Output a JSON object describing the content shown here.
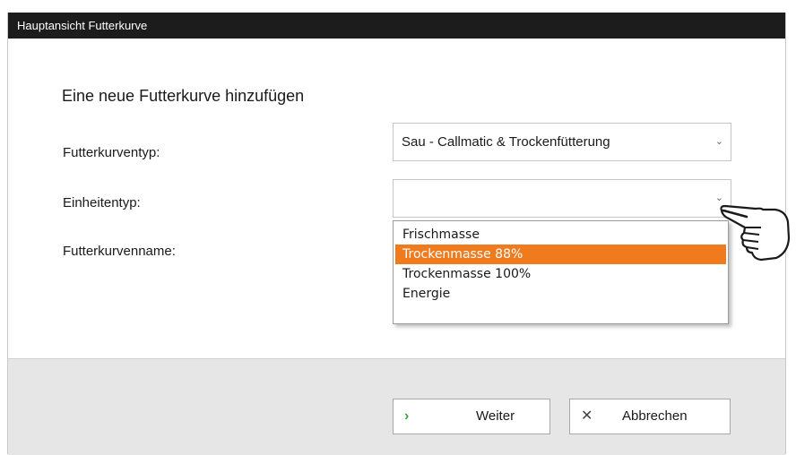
{
  "window": {
    "title": "Hauptansicht Futterkurve"
  },
  "form": {
    "heading": "Eine neue Futterkurve hinzufügen",
    "curve_type_label": "Futterkurventyp:",
    "curve_type_value": "Sau - Callmatic & Trockenfütterung",
    "unit_type_label": "Einheitentyp:",
    "unit_type_value": "",
    "curve_name_label": "Futterkurvenname:"
  },
  "dropdown": {
    "options": [
      "Frischmasse",
      "Trockenmasse 88%",
      "Trockenmasse 100%",
      "Energie"
    ],
    "highlighted": "Trockenmasse 88%"
  },
  "buttons": {
    "next_label": "Weiter",
    "cancel_label": "Abbrechen"
  },
  "icons": {
    "next": "chevron-right-icon",
    "cancel": "close-icon",
    "select_arrow": "chevron-down-icon",
    "pointer": "pointing-hand-icon"
  },
  "colors": {
    "titlebar": "#1c1c1c",
    "highlight": "#f07b1e",
    "next_icon": "#3aa63a",
    "footer": "#e6e6e6"
  }
}
